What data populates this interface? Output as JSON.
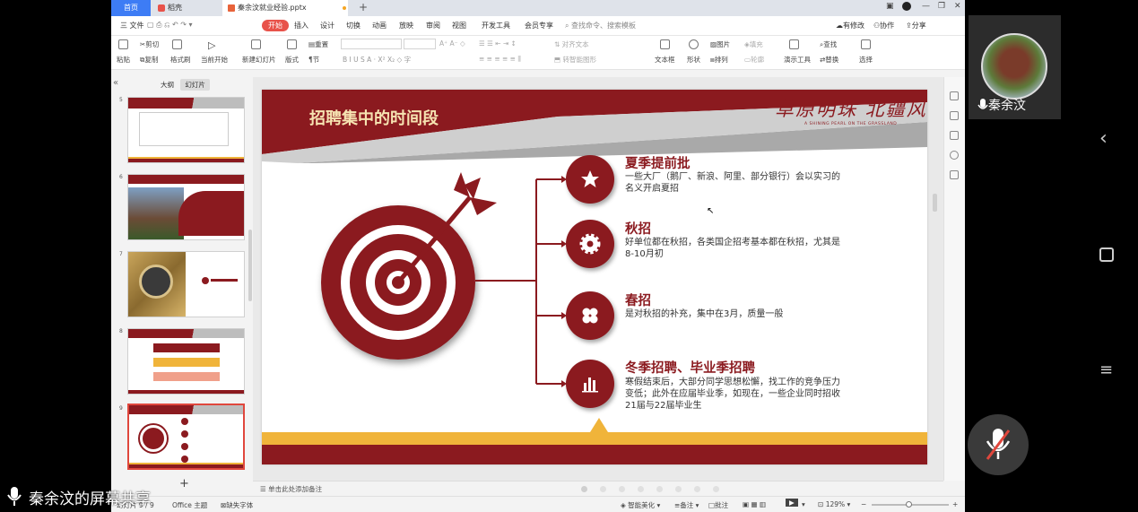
{
  "window": {
    "tabs": {
      "home": "首页",
      "daoke": "稻壳",
      "file": "秦余汶就业经验.pptx"
    },
    "menu": [
      "三 文件",
      "开始",
      "插入",
      "设计",
      "切换",
      "动画",
      "放映",
      "审阅",
      "视图",
      "开发工具",
      "会员专享"
    ],
    "search_placeholder": "查找命令、搜索模板",
    "right_menu": {
      "unsaved": "有修改",
      "collab": "协作",
      "share": "分享"
    },
    "ribbon": {
      "paste": "粘贴",
      "cut": "剪切",
      "copy": "复制",
      "format_painter": "格式刷",
      "from_current": "当前开始",
      "new_slide": "新建幻灯片",
      "layout": "版式",
      "section": "节",
      "reset": "重置",
      "text_box": "文本框",
      "shape": "形状",
      "picture": "图片",
      "arrange": "排列",
      "fill": "填充",
      "outline": "轮廓",
      "presenter": "演示工具",
      "find": "查找",
      "replace": "替换",
      "select": "选择",
      "align_text": "对齐文本",
      "smartart": "转智能图形"
    },
    "panel_tabs": {
      "outline": "大纲",
      "slides": "幻灯片"
    },
    "slide_numbers": [
      "5",
      "6",
      "7",
      "8",
      "9"
    ],
    "notes_placeholder": "单击此处添加备注",
    "status": {
      "slide_info": "幻灯片 9 / 9",
      "theme": "Office 主题",
      "missing_fonts": "缺失字体",
      "smart_beautify": "智能美化",
      "notes": "备注",
      "comments": "批注",
      "zoom": "129%"
    }
  },
  "slide": {
    "title": "招聘集中的时间段",
    "calligraphy": "草原明珠 北疆风华",
    "calligraphy_en": "A SHINING PEARL ON THE GRASSLAND",
    "items": [
      {
        "title": "夏季提前批",
        "desc": "一些大厂（鹅厂、新浪、阿里、部分银行）会以实习的名义开启夏招",
        "icon": "star-icon"
      },
      {
        "title": "秋招",
        "desc": "好单位都在秋招，各类国企招考基本都在秋招，尤其是8-10月初",
        "icon": "gear-icon"
      },
      {
        "title": "春招",
        "desc": "是对秋招的补充，集中在3月，质量一般",
        "icon": "clover-icon"
      },
      {
        "title": "冬季招聘、毕业季招聘",
        "desc": "寒假结束后，大部分同学思想松懈，找工作的竞争压力变低；此外在应届毕业季，如现在，一些企业同时招收21届与22届毕业生",
        "icon": "bar-chart-icon"
      }
    ]
  },
  "overlay": {
    "screen_share": "秦余汶的屏幕共享",
    "speaker": "秦余汶"
  },
  "colors": {
    "brand": "#8b1a1f",
    "gold": "#f0b43a",
    "accent": "#e8524a"
  }
}
